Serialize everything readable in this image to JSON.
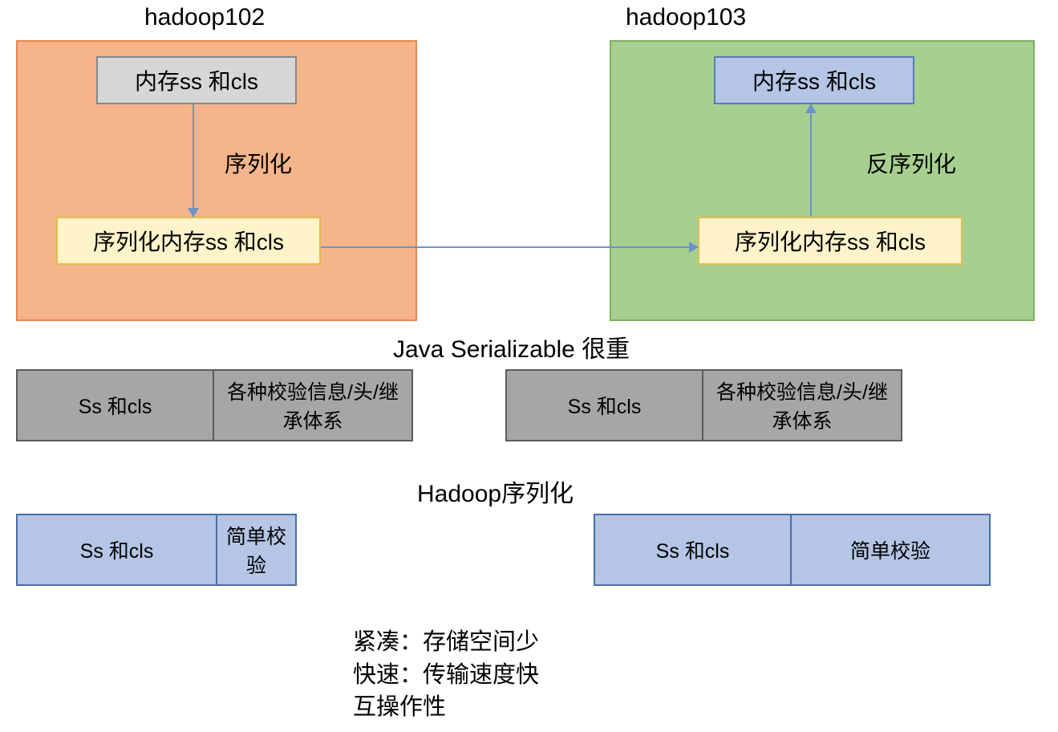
{
  "hosts": {
    "left": {
      "title": "hadoop102"
    },
    "right": {
      "title": "hadoop103"
    }
  },
  "boxes": {
    "mem_gray": "内存ss 和cls",
    "mem_blue": "内存ss 和cls",
    "ser_yellow1": "序列化内存ss 和cls",
    "ser_yellow2": "序列化内存ss 和cls"
  },
  "arrows": {
    "serialize": "序列化",
    "deserialize": "反序列化"
  },
  "sections": {
    "java_title": "Java  Serializable   很重",
    "hadoop_title": "Hadoop序列化"
  },
  "java_row": {
    "left": {
      "c1": "Ss 和cls",
      "c2": "各种校验信息/头/继承体系"
    },
    "right": {
      "c1": "Ss 和cls",
      "c2": "各种校验信息/头/继承体系"
    }
  },
  "hadoop_row": {
    "left": {
      "c1": "Ss 和cls",
      "c2": "简单校验"
    },
    "right": {
      "c1": "Ss 和cls",
      "c2": "简单校验"
    }
  },
  "benefits": {
    "line1": "紧凑：存储空间少",
    "line2": "快速：传输速度快",
    "line3": "互操作性"
  }
}
